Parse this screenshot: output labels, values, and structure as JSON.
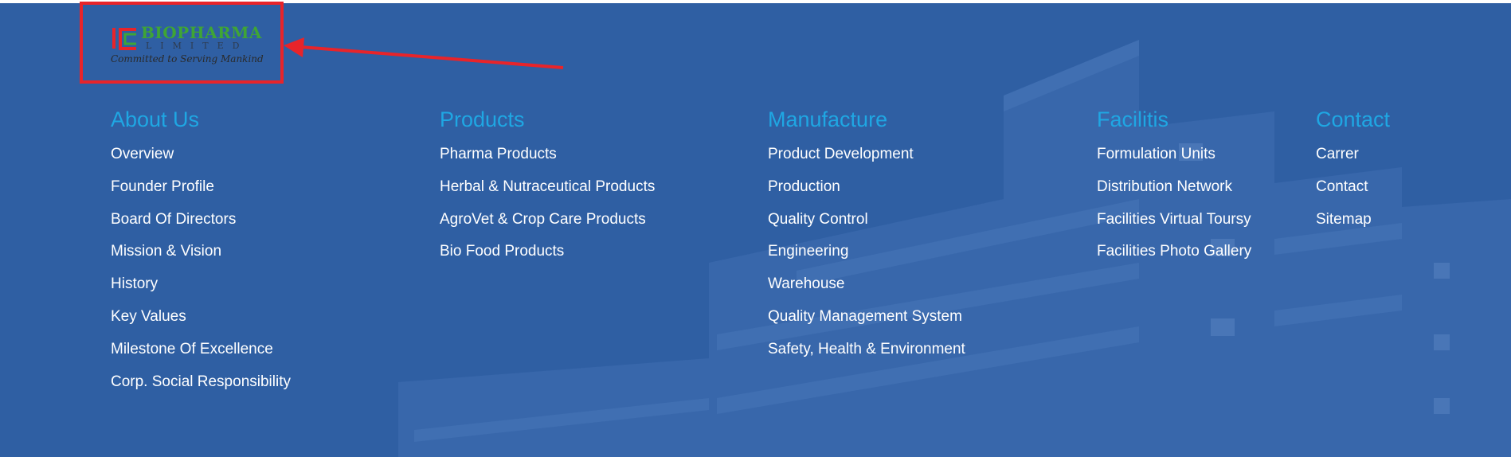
{
  "logo": {
    "brand": "BIOPHARMA",
    "sub": "LIMITED",
    "tagline": "Committed to Serving Mankind",
    "colors": {
      "brand": "#3fa535",
      "mark": "#e8242a"
    }
  },
  "annotation": {
    "color": "#e8242a"
  },
  "footer": {
    "columns": [
      {
        "heading": "About Us",
        "links": [
          "Overview",
          "Founder Profile",
          "Board Of Directors",
          "Mission & Vision",
          "History",
          "Key Values",
          "Milestone Of Excellence",
          "Corp. Social Responsibility"
        ]
      },
      {
        "heading": "Products",
        "links": [
          "Pharma Products",
          "Herbal & Nutraceutical Products",
          "AgroVet & Crop Care Products",
          "Bio Food Products"
        ]
      },
      {
        "heading": "Manufacture",
        "links": [
          "Product Development",
          "Production",
          "Quality Control",
          "Engineering",
          "Warehouse",
          "Quality Management System",
          "Safety, Health & Environment"
        ]
      },
      {
        "heading": "Facilitis",
        "links": [
          "Formulation Units",
          "Distribution Network",
          "Facilities Virtual Toursy",
          "Facilities Photo Gallery"
        ]
      },
      {
        "heading": "Contact",
        "links": [
          "Carrer",
          "Contact",
          "Sitemap"
        ]
      }
    ]
  }
}
